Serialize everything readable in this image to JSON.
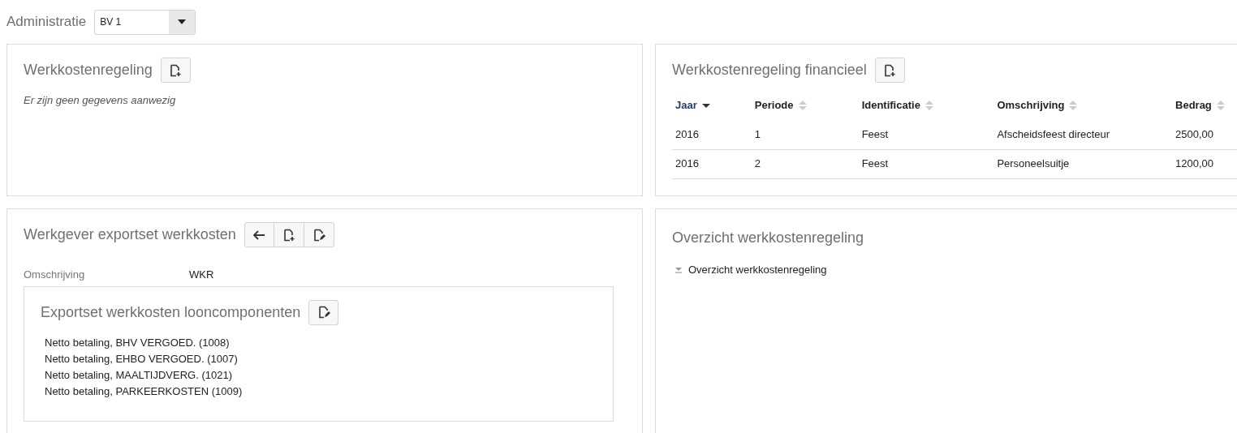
{
  "administratie": {
    "label": "Administratie",
    "value": "BV 1"
  },
  "werkkostenregeling": {
    "title": "Werkkostenregeling",
    "toolbar": [
      {
        "kind": "new"
      }
    ],
    "empty_message": "Er zijn geen gegevens aanwezig"
  },
  "financieel": {
    "title": "Werkkostenregeling financieel",
    "toolbar": [
      {
        "kind": "new"
      }
    ],
    "table": {
      "columns": [
        {
          "label": "Jaar",
          "sorted": true,
          "descending": true
        },
        {
          "label": "Periode",
          "sorted": false
        },
        {
          "label": "Identificatie",
          "sorted": false
        },
        {
          "label": "Omschrijving",
          "sorted": false
        },
        {
          "label": "Bedrag",
          "sorted": false
        }
      ],
      "rows": [
        [
          "2016",
          "1",
          "Feest",
          "Afscheidsfeest directeur",
          "2500,00"
        ],
        [
          "2016",
          "2",
          "Feest",
          "Personeelsuitje",
          "1200,00"
        ]
      ]
    }
  },
  "exportset": {
    "title": "Werkgever exportset werkkosten",
    "toolbar": [
      {
        "kind": "back"
      },
      {
        "kind": "new"
      },
      {
        "kind": "edit"
      }
    ],
    "field": {
      "label": "Omschrijving",
      "value": "WKR"
    },
    "looncomponenten": {
      "title": "Exportset werkkosten looncomponenten",
      "toolbar": [
        {
          "kind": "edit"
        }
      ],
      "items": [
        "Netto betaling, BHV VERGOED. (1008)",
        "Netto betaling, EHBO VERGOED. (1007)",
        "Netto betaling, MAALTIJDVERG. (1021)",
        "Netto betaling, PARKEERKOSTEN (1009)"
      ]
    }
  },
  "overzicht": {
    "title": "Overzicht werkkostenregeling",
    "tree": [
      {
        "label": "Overzicht werkkostenregeling",
        "expanded": true
      }
    ]
  }
}
